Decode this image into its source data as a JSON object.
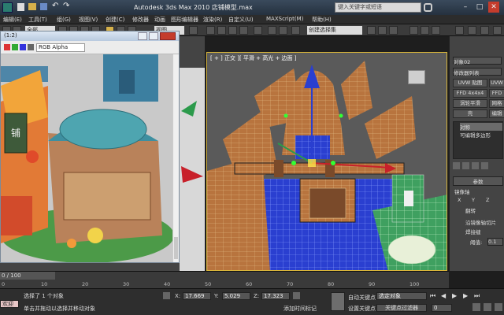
{
  "window": {
    "app_title": "Autodesk 3ds Max 2010   店铺模型.max",
    "search_placeholder": "键入关键字或短语",
    "minimize": "–",
    "maximize": "□",
    "close": "✕"
  },
  "menubar": {
    "items": [
      "编辑(E)",
      "工具(T)",
      "组(G)",
      "视图(V)",
      "创建(C)",
      "修改器",
      "动画",
      "图形编辑器",
      "渲染(R)",
      "自定义(U)",
      "MAXScript(M)",
      "帮助(H)"
    ]
  },
  "toolbar": {
    "view_selector": "全部",
    "viewport_dropdown": "视图",
    "selection_set": "创建选择集"
  },
  "render_window": {
    "title": "(1:2)",
    "channel": "RGB Alpha",
    "sign_text": "铺"
  },
  "viewport": {
    "label": "[ + ] 正交 ][ 平滑 + 高光 + 边面 ]"
  },
  "command_panel": {
    "object_name": "对象02",
    "modifier_list": "修改器列表",
    "buttons": [
      "UVW 贴图",
      "UVW",
      "FFD 4x4x4",
      "FFD",
      "涡轮平滑",
      "网格",
      "壳",
      "编辑"
    ],
    "stack": [
      "对称",
      "可编辑多边形"
    ],
    "params_title": "参数",
    "mirror_axis": "镜像轴",
    "axes": [
      "X",
      "Y",
      "Z"
    ],
    "flip": "翻转",
    "slice_option": "沿镜像轴切片",
    "weld_option": "焊接缝",
    "threshold_label": "阈值:",
    "threshold_value": "0.1"
  },
  "timeline": {
    "frame_counter": "0 / 100",
    "ticks": [
      "0",
      "10",
      "20",
      "30",
      "40",
      "50",
      "60",
      "70",
      "80",
      "90",
      "100"
    ]
  },
  "statusbar": {
    "selection_status": "选择了 1 个对象",
    "prompt": "单击并拖动以选择并移动对象",
    "script_listener": "欢迎使用 MAXScr",
    "x_label": "X:",
    "x_value": "17.669",
    "y_label": "Y:",
    "y_value": "5.029",
    "z_label": "Z:",
    "z_value": "17.323",
    "auto_key": "自动关键点",
    "selected_object": "选定对象",
    "set_key": "设置关键点",
    "key_filters": "关键点过滤器",
    "add_time_tag": "添加时间标记",
    "frame_value": "0"
  },
  "colors": {
    "viewport_border": "#d8b53a",
    "wood": "#b8743e",
    "blue_tiles": "#2a3fd0",
    "green_ground": "#3fa060"
  }
}
